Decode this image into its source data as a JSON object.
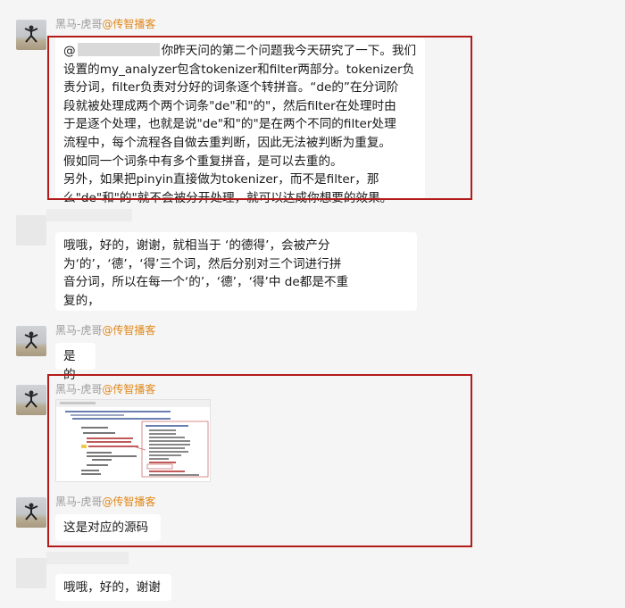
{
  "messages": [
    {
      "sender": "黑马-虎哥",
      "sender_tag": "@传智播客",
      "mention": "@",
      "lines": [
        "你昨天问的第二个问题我今天研究了一下。我们",
        "设置的my_analyzer包含tokenizer和filter两部分。tokenizer负",
        "责分词，filter负责对分好的词条逐个转拼音。“de的”在分词阶",
        "段就被处理成两个两个词条\"de\"和\"的\"，然后filter在处理时由",
        "于是逐个处理，也就是说\"de\"和\"的\"是在两个不同的filter处理",
        "流程中，每个流程各自做去重判断，因此无法被判断为重复。",
        "假如同一个词条中有多个重复拼音，是可以去重的。",
        "另外，如果把pinyin直接做为tokenizer，而不是filter，那",
        "么\"de\"和\"的\"就不会被分开处理，就可以达成你想要的效果。"
      ]
    },
    {
      "lines": [
        "哦哦，好的，谢谢，就相当于 ‘的德得’，会被产分",
        "为‘的’，‘德’，‘得’三个词，然后分别对三个词进行拼",
        "音分词，所以在每一个‘的’，‘德’，‘得’中 de都是不重",
        "复的，"
      ]
    },
    {
      "sender": "黑马-虎哥",
      "sender_tag": "@传智播客",
      "text": "是的"
    },
    {
      "sender": "黑马-虎哥",
      "sender_tag": "@传智播客",
      "image": "code-screenshot"
    },
    {
      "sender": "黑马-虎哥",
      "sender_tag": "@传智播客",
      "text": "这是对应的源码"
    },
    {
      "text": "哦哦，好的，谢谢"
    }
  ],
  "colors": {
    "background": "#f5f5f5",
    "bubble": "#ffffff",
    "highlight": "#b31b1b",
    "sender_tag": "#e0891b",
    "sender_name": "#9b9b9b"
  },
  "icons": [
    "user-avatar-icon"
  ]
}
